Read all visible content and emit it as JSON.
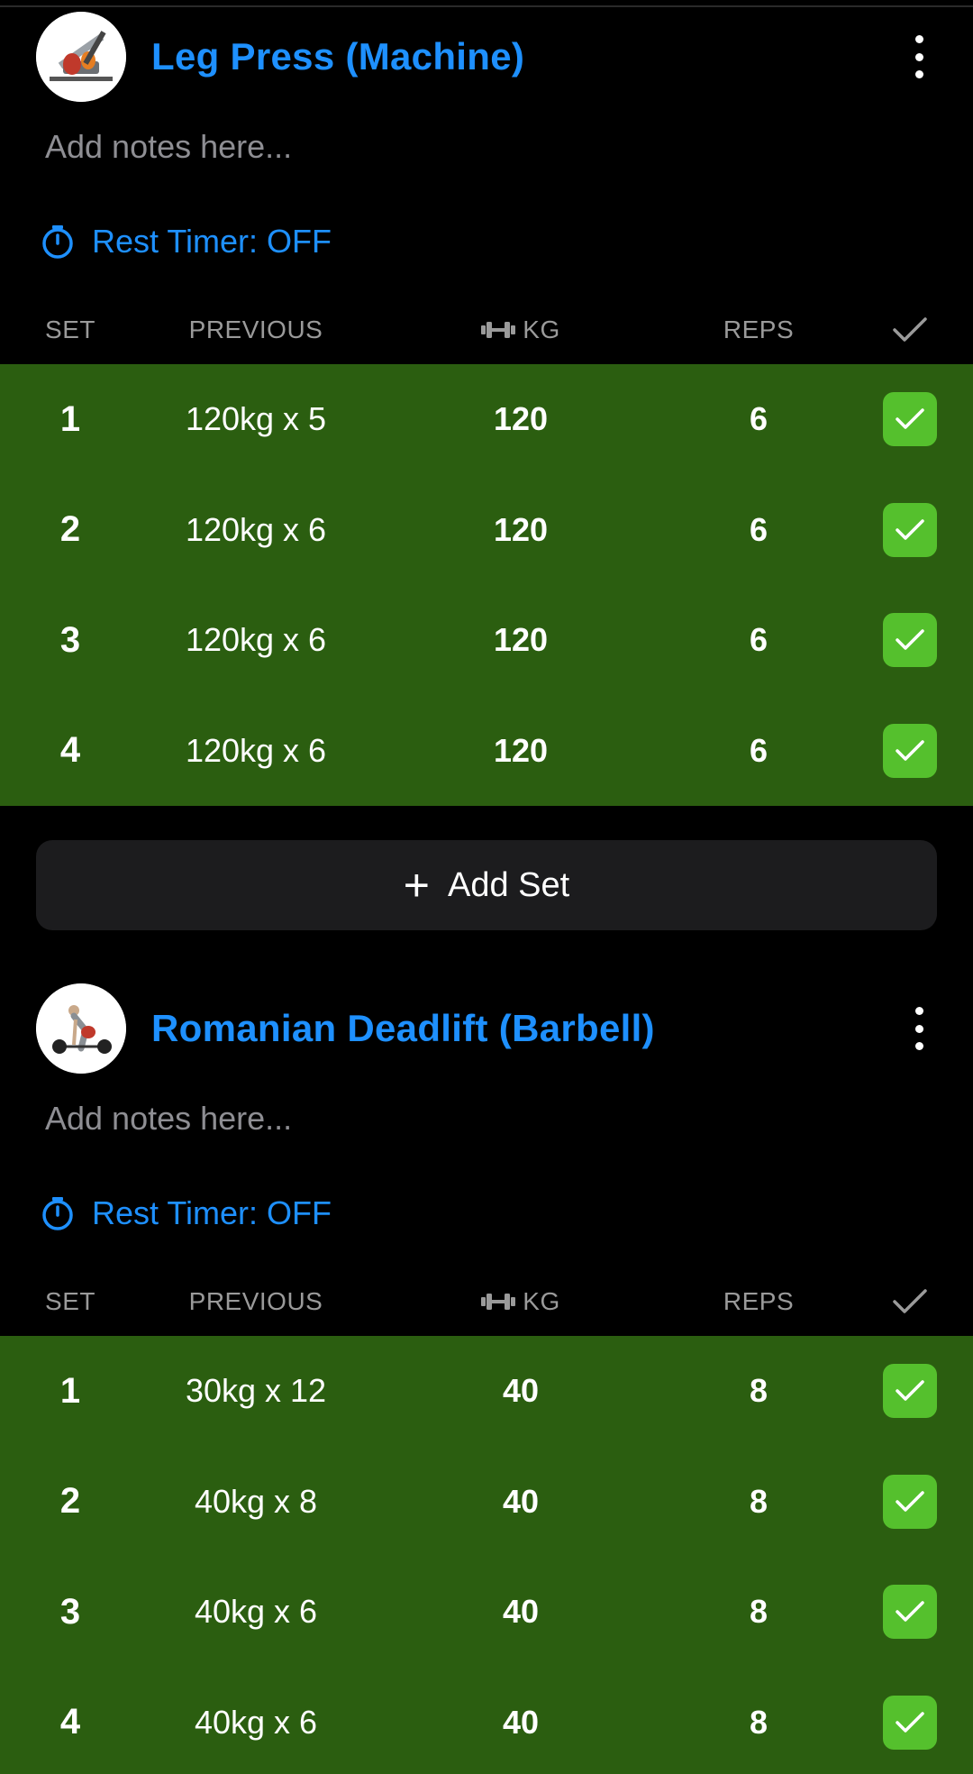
{
  "exercises": [
    {
      "title": "Leg Press (Machine)",
      "image_icon": "leg-press-illustration",
      "notes_placeholder": "Add notes here...",
      "rest_timer": "Rest Timer: OFF",
      "columns": {
        "set": "SET",
        "previous": "PREVIOUS",
        "kg": "KG",
        "reps": "REPS"
      },
      "sets": [
        {
          "set": "1",
          "previous": "120kg x 5",
          "kg": "120",
          "reps": "6",
          "completed": true
        },
        {
          "set": "2",
          "previous": "120kg x 6",
          "kg": "120",
          "reps": "6",
          "completed": true
        },
        {
          "set": "3",
          "previous": "120kg x 6",
          "kg": "120",
          "reps": "6",
          "completed": true
        },
        {
          "set": "4",
          "previous": "120kg x 6",
          "kg": "120",
          "reps": "6",
          "completed": true
        }
      ],
      "add_set_label": "Add Set"
    },
    {
      "title": "Romanian Deadlift (Barbell)",
      "image_icon": "deadlift-illustration",
      "notes_placeholder": "Add notes here...",
      "rest_timer": "Rest Timer: OFF",
      "columns": {
        "set": "SET",
        "previous": "PREVIOUS",
        "kg": "KG",
        "reps": "REPS"
      },
      "sets": [
        {
          "set": "1",
          "previous": "30kg x 12",
          "kg": "40",
          "reps": "8",
          "completed": true
        },
        {
          "set": "2",
          "previous": "40kg x 8",
          "kg": "40",
          "reps": "8",
          "completed": true
        },
        {
          "set": "3",
          "previous": "40kg x 6",
          "kg": "40",
          "reps": "8",
          "completed": true
        },
        {
          "set": "4",
          "previous": "40kg x 6",
          "kg": "40",
          "reps": "8",
          "completed": true
        }
      ]
    }
  ],
  "colors": {
    "accent": "#1e90ff",
    "completed_row": "#2b5e10",
    "check": "#55c02d",
    "button_bg": "#1c1c1e"
  }
}
